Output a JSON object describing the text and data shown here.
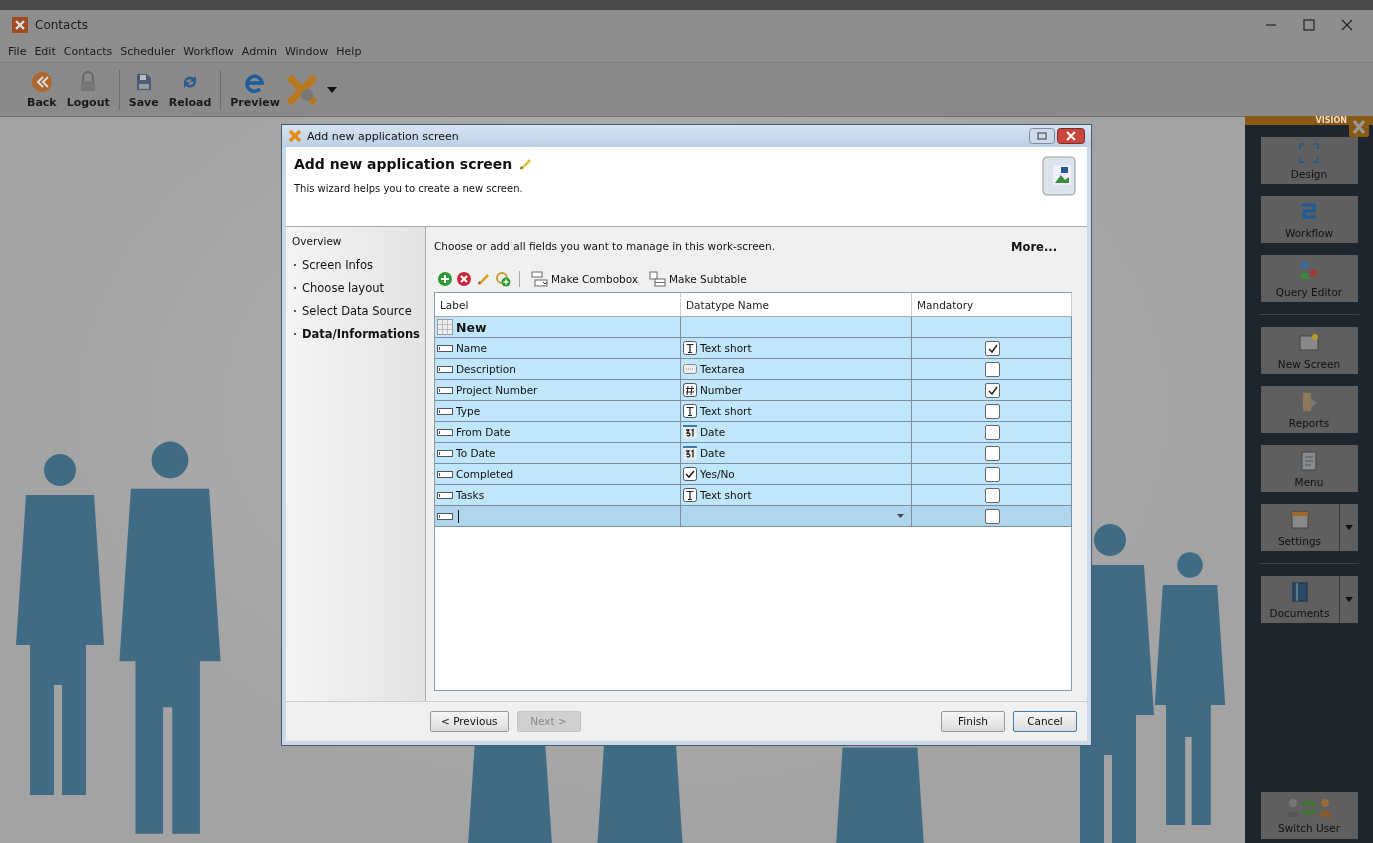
{
  "window": {
    "title": "Contacts"
  },
  "menu": [
    "File",
    "Edit",
    "Contacts",
    "Scheduler",
    "Workflow",
    "Admin",
    "Window",
    "Help"
  ],
  "toolbar": [
    {
      "label": "Back",
      "kind": "back"
    },
    {
      "label": "Logout",
      "kind": "logout"
    },
    {
      "label": "Save",
      "kind": "save"
    },
    {
      "label": "Reload",
      "kind": "reload"
    },
    {
      "label": "Preview",
      "kind": "preview"
    }
  ],
  "side_panel": {
    "brand": "VISION",
    "buttons": [
      {
        "label": "Design",
        "kind": "design",
        "dropdown": false
      },
      {
        "label": "Workflow",
        "kind": "workflow",
        "dropdown": false
      },
      {
        "label": "Query Editor",
        "kind": "query",
        "dropdown": false
      },
      {
        "label": "New Screen",
        "kind": "screen",
        "dropdown": false
      },
      {
        "label": "Reports",
        "kind": "reports",
        "dropdown": false
      },
      {
        "label": "Menu",
        "kind": "menu",
        "dropdown": false
      },
      {
        "label": "Settings",
        "kind": "settings",
        "dropdown": true
      },
      {
        "label": "Documents",
        "kind": "documents",
        "dropdown": true
      }
    ],
    "switch_user": "Switch User"
  },
  "dialog": {
    "title": "Add new application screen",
    "heading": "Add new application screen",
    "subtitle": "This wizard helps you to create a new screen.",
    "overview": "Overview",
    "steps": [
      {
        "label": "Screen Infos",
        "selected": false
      },
      {
        "label": "Choose layout",
        "selected": false
      },
      {
        "label": "Select Data Source",
        "selected": false
      },
      {
        "label": "Data/Informations",
        "selected": true
      }
    ],
    "instruction": "Choose or add all fields you want to manage in this work-screen.",
    "more": "More...",
    "actions": [
      "Make Combobox",
      "Make Subtable"
    ],
    "columns": [
      "Label",
      "Datatype Name",
      "Mandatory"
    ],
    "new_row": "New",
    "rows": [
      {
        "label": "Name",
        "datatype": "Text short",
        "kind": "text",
        "mandatory": true
      },
      {
        "label": "Description",
        "datatype": "Textarea",
        "kind": "textarea",
        "mandatory": false
      },
      {
        "label": "Project Number",
        "datatype": "Number",
        "kind": "number",
        "mandatory": true
      },
      {
        "label": "Type",
        "datatype": "Text short",
        "kind": "text",
        "mandatory": false
      },
      {
        "label": "From Date",
        "datatype": "Date",
        "kind": "date",
        "mandatory": false
      },
      {
        "label": "To Date",
        "datatype": "Date",
        "kind": "date",
        "mandatory": false
      },
      {
        "label": "Completed",
        "datatype": "Yes/No",
        "kind": "boolean",
        "mandatory": false
      },
      {
        "label": "Tasks",
        "datatype": "Text short",
        "kind": "text",
        "mandatory": false
      }
    ],
    "edit_row": {
      "mandatory": false
    },
    "buttons": [
      {
        "label": "< Previous",
        "disabled": false
      },
      {
        "label": "Next >",
        "disabled": true
      },
      {
        "label": "Finish",
        "disabled": false
      },
      {
        "label": "Cancel",
        "disabled": false
      }
    ]
  }
}
